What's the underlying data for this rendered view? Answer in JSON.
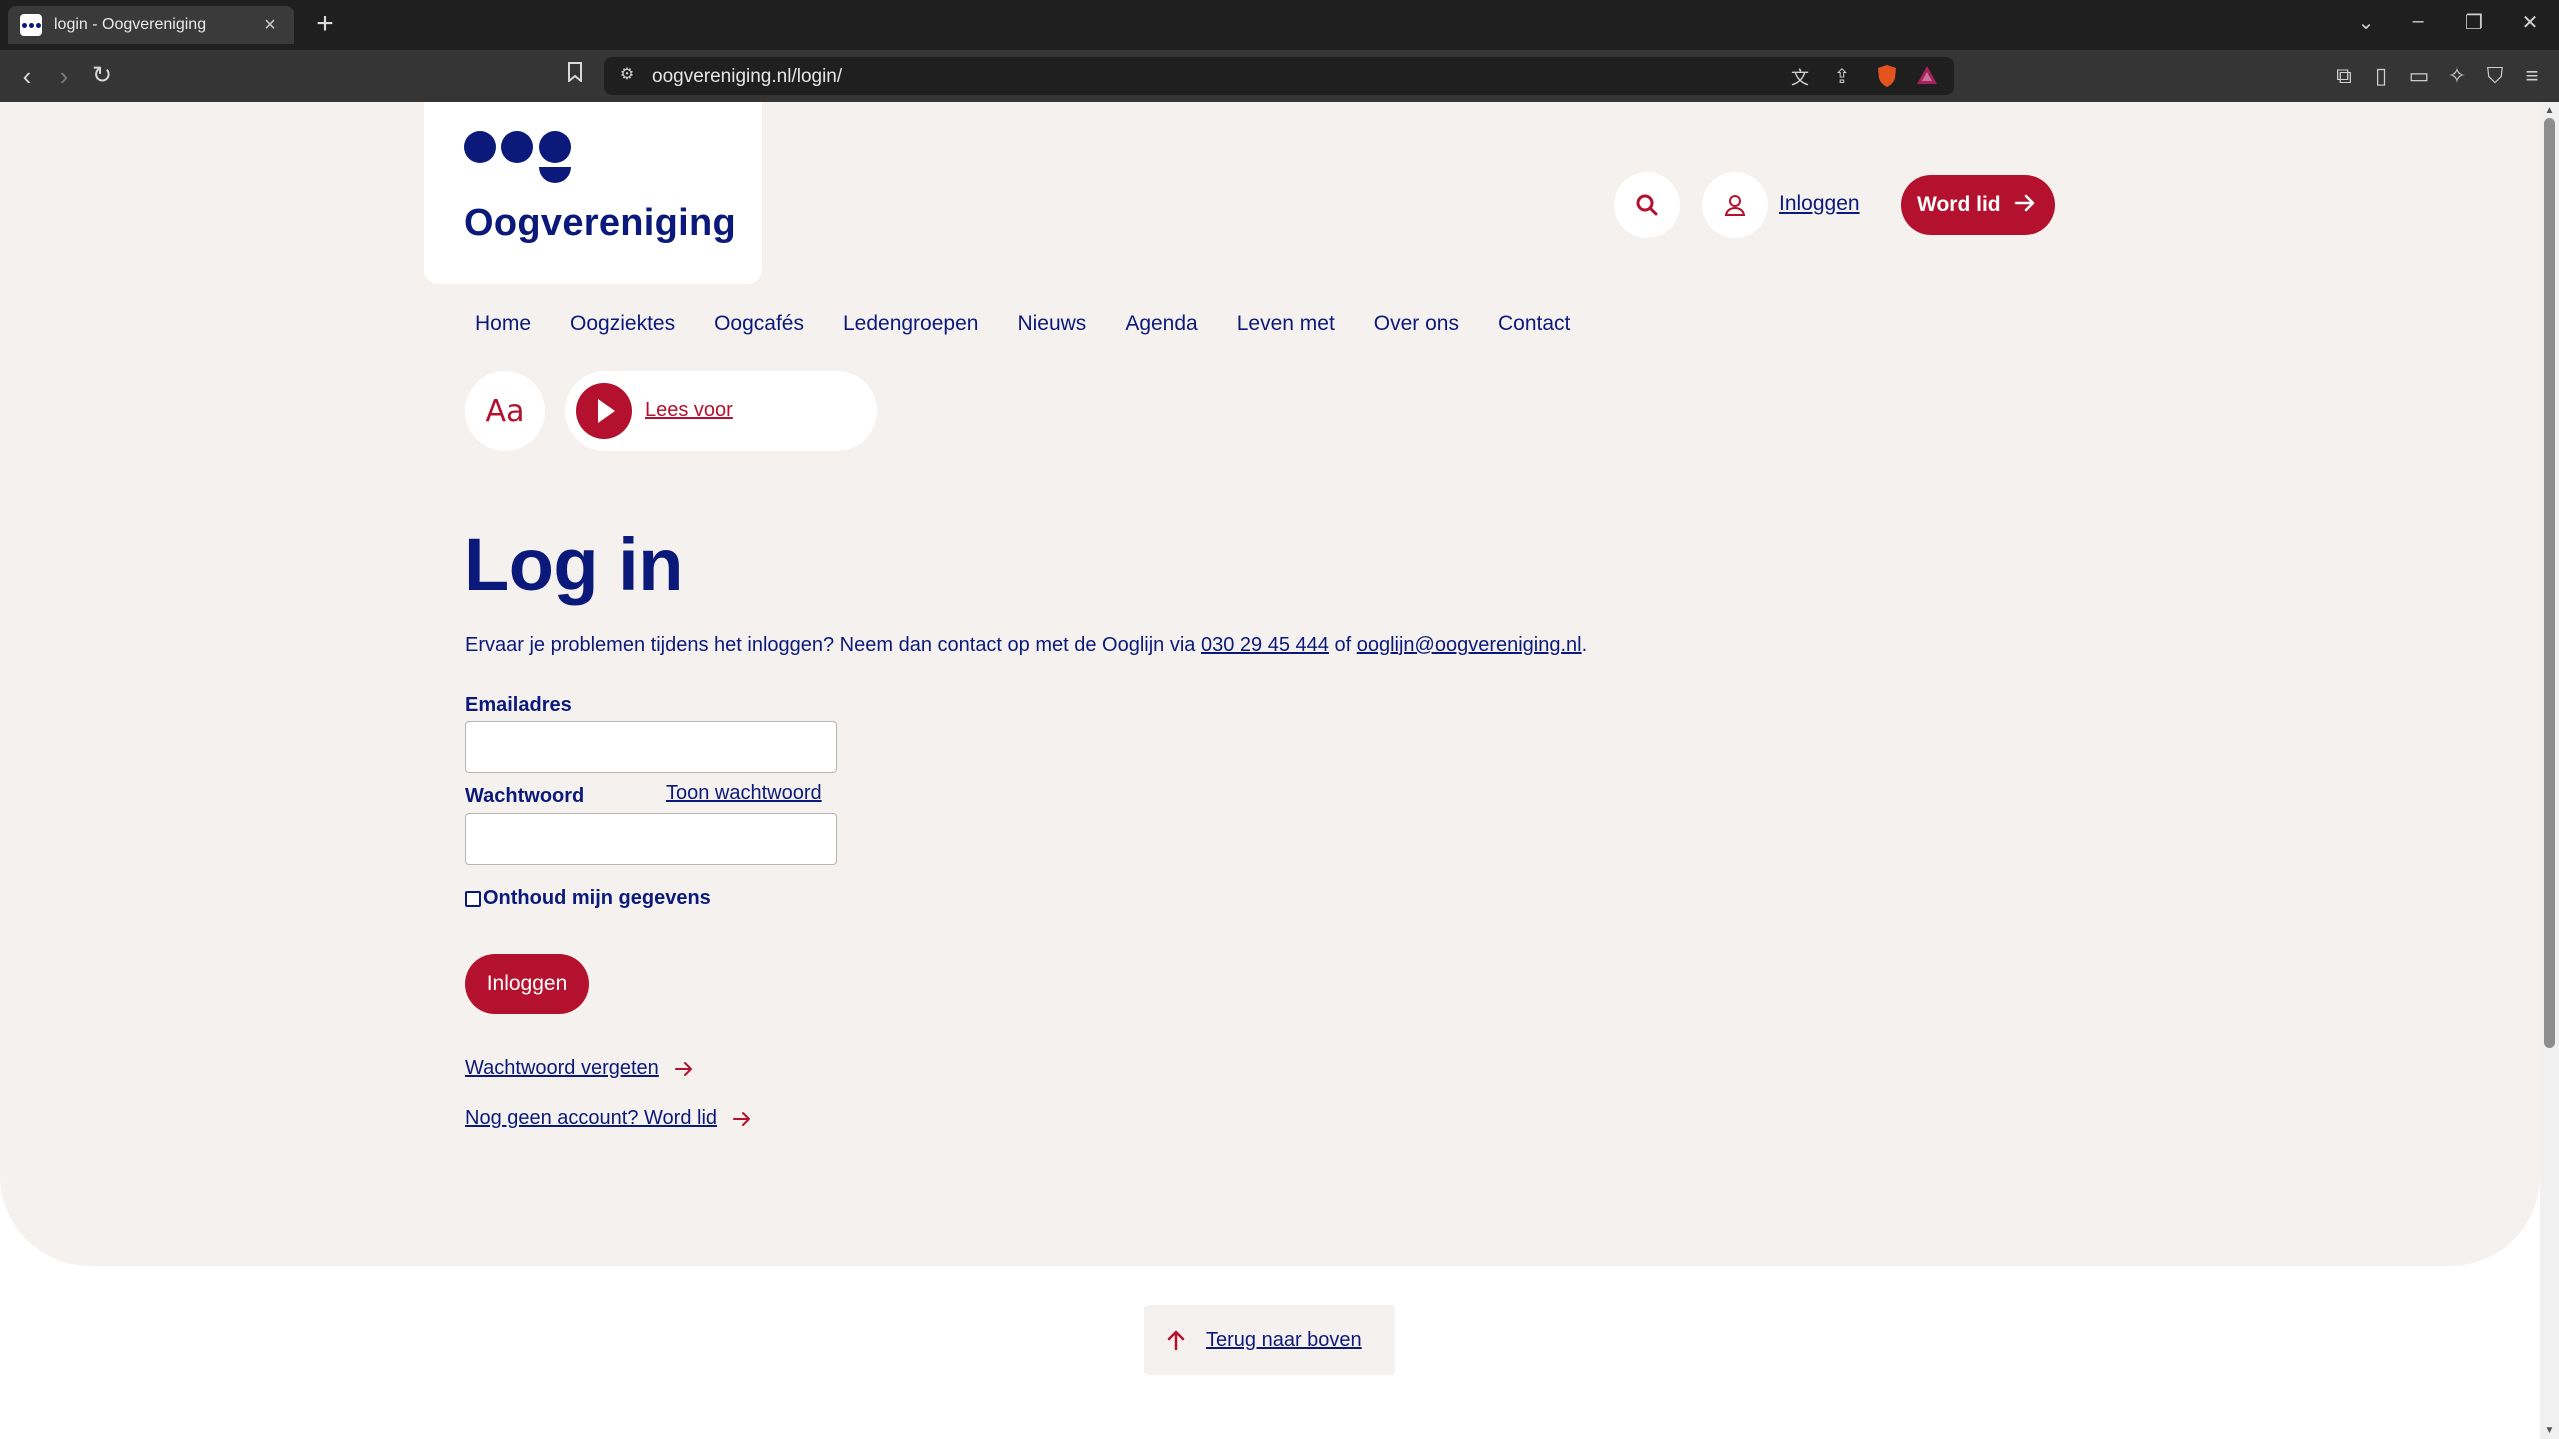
{
  "browser": {
    "tab_title": "login - Oogvereniging",
    "new_tab_icon": "plus-icon",
    "url": "oogvereniging.nl/login/"
  },
  "site": {
    "logo_text": "Oogvereniging",
    "header": {
      "login_label": "Inloggen",
      "join_label": "Word lid"
    },
    "nav": [
      "Home",
      "Oogziektes",
      "Oogcafés",
      "Ledengroepen",
      "Nieuws",
      "Agenda",
      "Leven met",
      "Over ons",
      "Contact"
    ],
    "text_size_label": "Aa",
    "read_aloud_label": "Lees voor"
  },
  "login": {
    "title": "Log in",
    "intro_prefix": "Ervaar je problemen tijdens het inloggen? Neem dan contact op met de Ooglijn via ",
    "phone": "030 29 45 444",
    "intro_middle": " of ",
    "email": "ooglijn@oogvereniging.nl",
    "intro_suffix": ".",
    "email_label": "Emailadres",
    "email_value": "",
    "password_label": "Wachtwoord",
    "password_value": "",
    "show_password_label": "Toon wachtwoord",
    "remember_label": "Onthoud mijn gegevens",
    "remember_checked": false,
    "submit_label": "Inloggen",
    "forgot_label": "Wachtwoord vergeten",
    "register_label": "Nog geen account? Word lid"
  },
  "footer": {
    "back_to_top_label": "Terug naar boven"
  },
  "colors": {
    "brand_blue": "#0b1a7a",
    "brand_red": "#b3112d",
    "page_bg": "#f5f1ee"
  }
}
